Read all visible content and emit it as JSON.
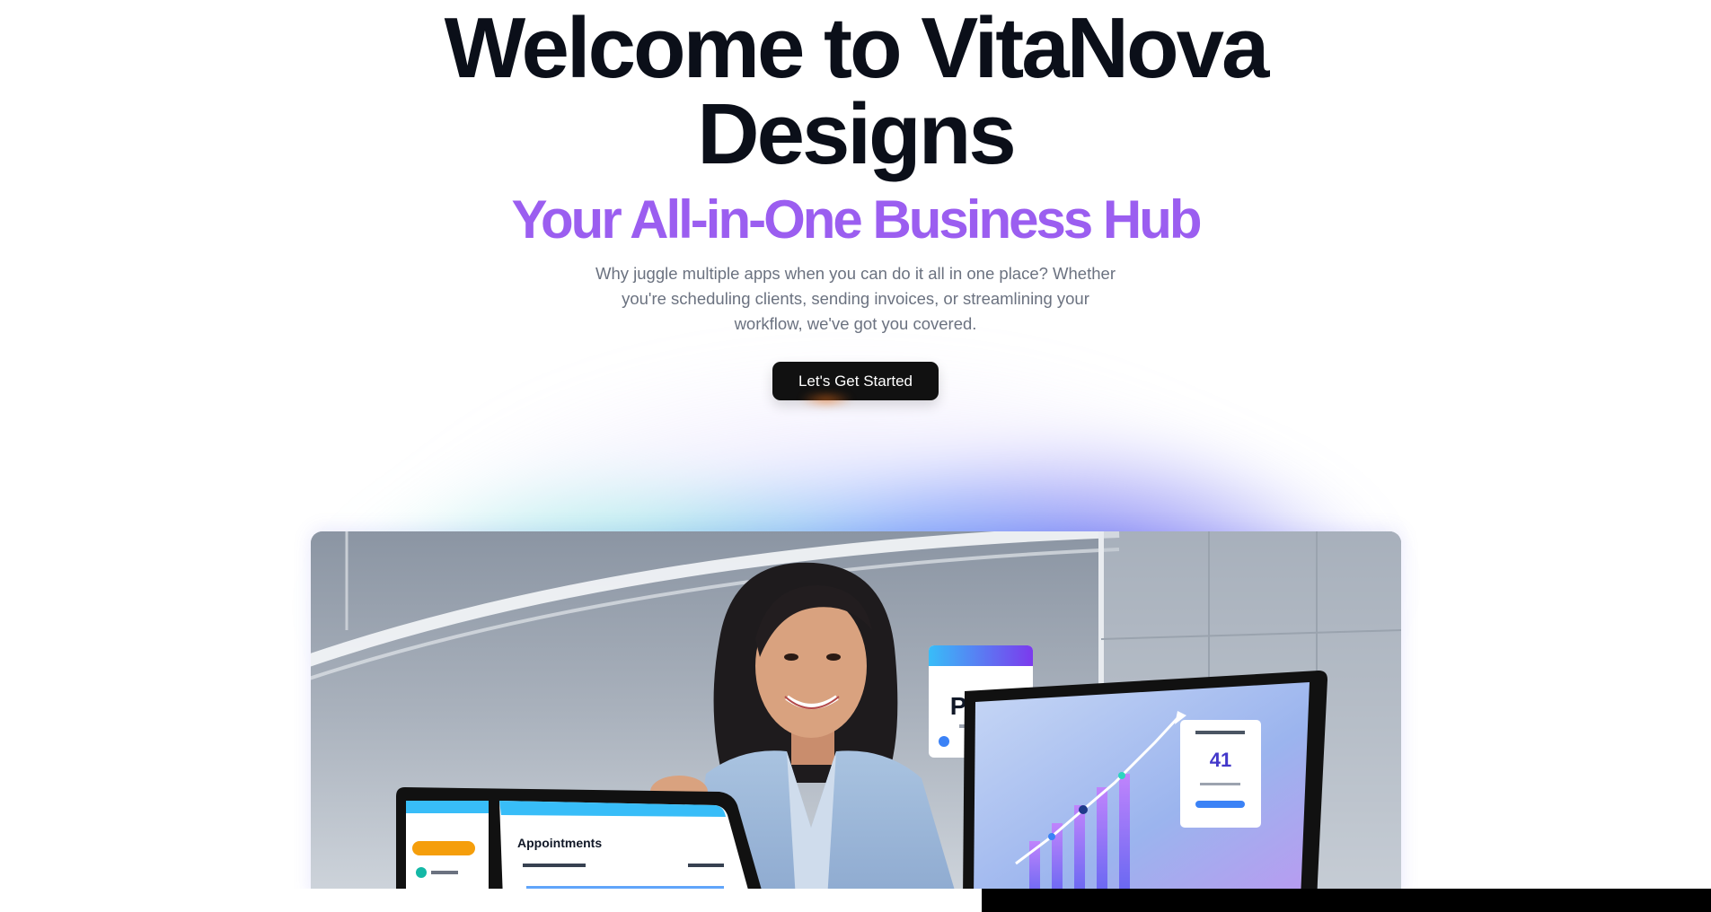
{
  "hero": {
    "title_line1": "Welcome to VitaNova",
    "title_line2": "Designs",
    "subtitle": "Your All-in-One Business Hub",
    "description": "Why juggle multiple apps when you can do it all in one place? Whether you're scheduling clients, sending invoices, or streamlining your workflow, we've got you covered.",
    "cta_label": "Let's Get Started"
  },
  "colors": {
    "title": "#0b0f19",
    "subtitle": "#9b5ef0",
    "description": "#6b7280",
    "cta_bg": "#111111",
    "cta_text": "#ffffff",
    "glow_teal": "#5eead4",
    "glow_blue": "#60a5fa",
    "glow_indigo": "#6366f1"
  },
  "hero_image": {
    "paid_card": {
      "title": "Paid!"
    },
    "tablet_screen": {
      "heading": "Appointments"
    },
    "monitor_screen": {
      "stat_value": "41"
    }
  }
}
